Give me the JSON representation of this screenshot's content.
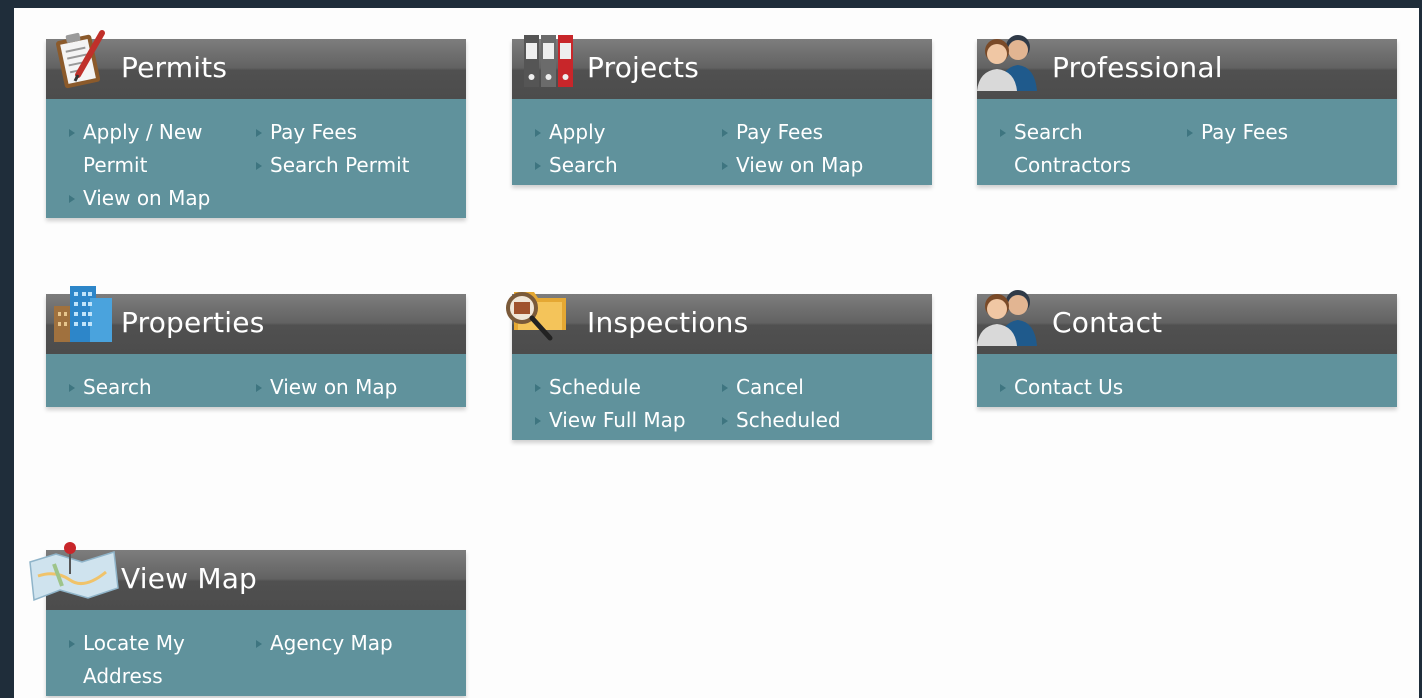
{
  "cards": {
    "permits": {
      "title": "Permits",
      "links": [
        "Apply / New Permit",
        "Pay Fees",
        "View on Map",
        "Search Permit"
      ]
    },
    "projects": {
      "title": "Projects",
      "links": [
        "Apply",
        "Pay Fees",
        "Search",
        "View on Map"
      ]
    },
    "professional": {
      "title": "Professional",
      "links": [
        "Search Contractors",
        "Pay Fees"
      ]
    },
    "properties": {
      "title": "Properties",
      "links": [
        "Search",
        "View on Map"
      ]
    },
    "inspections": {
      "title": "Inspections",
      "links": [
        "Schedule",
        "Cancel",
        "View Full Map",
        "Scheduled"
      ]
    },
    "contact": {
      "title": "Contact",
      "links": [
        "Contact Us"
      ]
    },
    "viewmap": {
      "title": "View Map",
      "links": [
        "Locate My Address",
        "Agency Map"
      ]
    }
  },
  "icons": {
    "permits": "clipboard-icon",
    "projects": "binders-icon",
    "professional": "people-icon",
    "properties": "buildings-icon",
    "inspections": "folder-magnifier-icon",
    "contact": "people-icon",
    "viewmap": "map-pin-icon"
  }
}
